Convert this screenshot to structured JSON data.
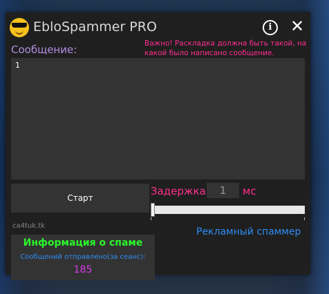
{
  "app": {
    "title": "EbloSpammer PRO",
    "logo_icon": "sunglasses-emoji-icon",
    "info_icon": "info-icon",
    "close_icon": "close-icon",
    "close_glyph": "✕",
    "info_glyph": "i"
  },
  "message": {
    "label": "Сообщение:",
    "value": "1",
    "warning": "Важно! Раскладка должна быть такой, на какой было написано сообщение."
  },
  "controls": {
    "start_label": "Старт",
    "delay_label": "Задержка:",
    "delay_value": "1",
    "delay_unit": "мс",
    "slider_value": 0
  },
  "footer": {
    "site": "ca4tuk.tk",
    "ad_spammer_link": "Рекламный спаммер"
  },
  "info": {
    "title": "Информация о спаме",
    "sent_label": "Сообщений отправлено(за сеанс):",
    "sent_count": "185"
  },
  "colors": {
    "accent_pink": "#ff2f8e",
    "accent_purple": "#b28fe0",
    "accent_blue": "#2f8ef5",
    "accent_green": "#2bf52b",
    "accent_magenta": "#d93ae8",
    "window_bg": "#1f1f1f",
    "panel_bg": "#333333"
  }
}
